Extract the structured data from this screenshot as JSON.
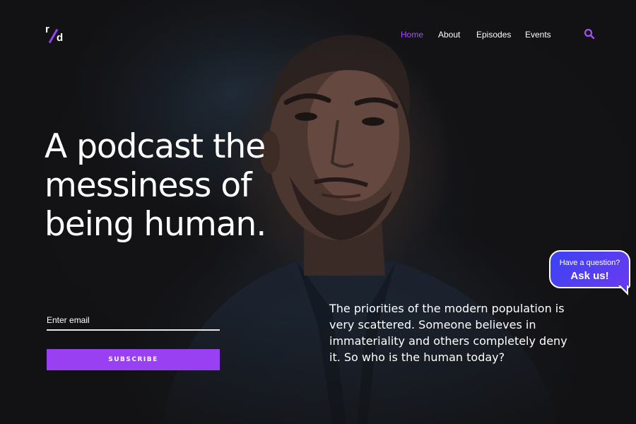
{
  "brand": {
    "logo_r": "r",
    "logo_d": "d",
    "accent_color": "#9a40f3"
  },
  "nav": {
    "items": [
      {
        "label": "Home",
        "active": true
      },
      {
        "label": "About",
        "active": false
      },
      {
        "label": "Episodes",
        "active": false
      },
      {
        "label": "Events",
        "active": false
      }
    ],
    "search_icon": "search-icon"
  },
  "hero": {
    "headline_line1": "A podcast the",
    "headline_line2": "messiness of",
    "headline_line3": "being human.",
    "tagline": "The priorities of the modern population is very scattered. Someone believes in immateriality and others completely deny it. So who is the human today?"
  },
  "subscribe": {
    "email_placeholder": "Enter email",
    "button_label": "SUBSCRIBE"
  },
  "chat": {
    "line1": "Have a question?",
    "line2": "Ask us!",
    "colors": [
      "#3b43f2",
      "#6a3af0"
    ]
  }
}
